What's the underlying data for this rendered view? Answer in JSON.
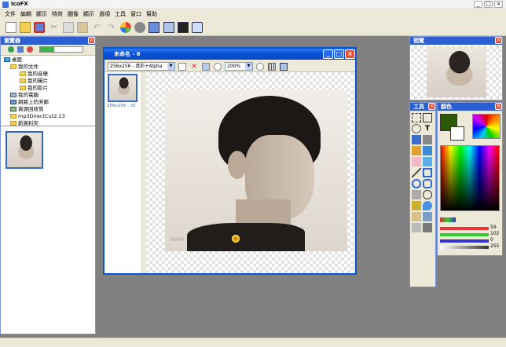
{
  "window": {
    "title": "IcoFX"
  },
  "menu": [
    "文件",
    "編輯",
    "顯示",
    "特效",
    "圖像",
    "顯示",
    "選項",
    "工具",
    "窗口",
    "幫助"
  ],
  "explorer": {
    "title": "瀏覽器",
    "tree": [
      {
        "label": "桌面",
        "level": 0
      },
      {
        "label": "我的文件",
        "level": 1
      },
      {
        "label": "我的音樂",
        "level": 2
      },
      {
        "label": "我的圖片",
        "level": 2
      },
      {
        "label": "我的影片",
        "level": 2
      },
      {
        "label": "我的電腦",
        "level": 1
      },
      {
        "label": "網路上的芳鄰",
        "level": 1
      },
      {
        "label": "資源回收筒",
        "level": 1
      },
      {
        "label": "mp3DirectCut2.13",
        "level": 1
      },
      {
        "label": "新資料夾",
        "level": 1
      }
    ]
  },
  "document": {
    "title": "未命名 - 6",
    "format_select": "256x256 - 真彩+Alpha",
    "zoom_select": "200%",
    "thumb_label": "256x256 - 32",
    "watermark": "WWW"
  },
  "preview": {
    "title": "預覽"
  },
  "tools": {
    "title": "工具"
  },
  "colors": {
    "title": "顏色",
    "primary": "#2d5a06",
    "rgba": [
      59,
      102,
      0,
      255
    ]
  }
}
